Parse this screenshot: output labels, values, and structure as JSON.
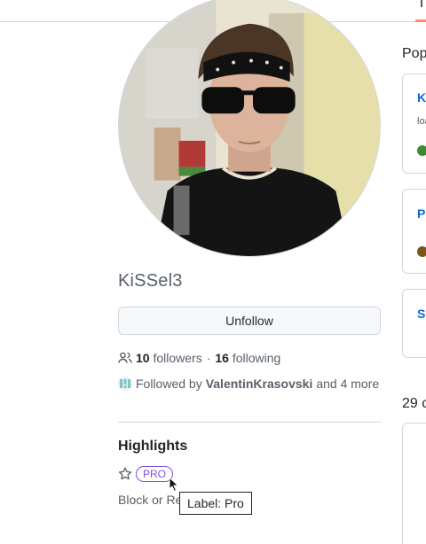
{
  "profile": {
    "username": "KiSSel3",
    "unfollow_label": "Unfollow",
    "followers_count": "10",
    "followers_label": "followers",
    "separator": "·",
    "following_count": "16",
    "following_label": "following",
    "followed_by_prefix": "Followed by",
    "followed_by_user": "ValentinKrasovski",
    "followed_by_suffix": "and 4 more"
  },
  "highlights": {
    "title": "Highlights",
    "pro_badge": "PRO",
    "block_report": "Block or Re"
  },
  "tooltip": {
    "text": "Label: Pro"
  },
  "sidebar": {
    "popular_title": "Pop",
    "repos": [
      {
        "name": "K",
        "desc": "loa",
        "lang_color": "#3e8a2f"
      },
      {
        "name": "P",
        "desc": "",
        "lang_color": "#7a5518"
      },
      {
        "name": "Sc",
        "desc": "",
        "lang_color": ""
      }
    ],
    "contrib_title": "29 c"
  },
  "icons": {
    "people": "people-icon",
    "star": "star-icon",
    "cursor": "mouse-pointer-icon"
  },
  "colors": {
    "link": "#0969da",
    "pro_purple": "#8250df",
    "muted": "#57606a",
    "tab_accent": "#fd8c73"
  }
}
